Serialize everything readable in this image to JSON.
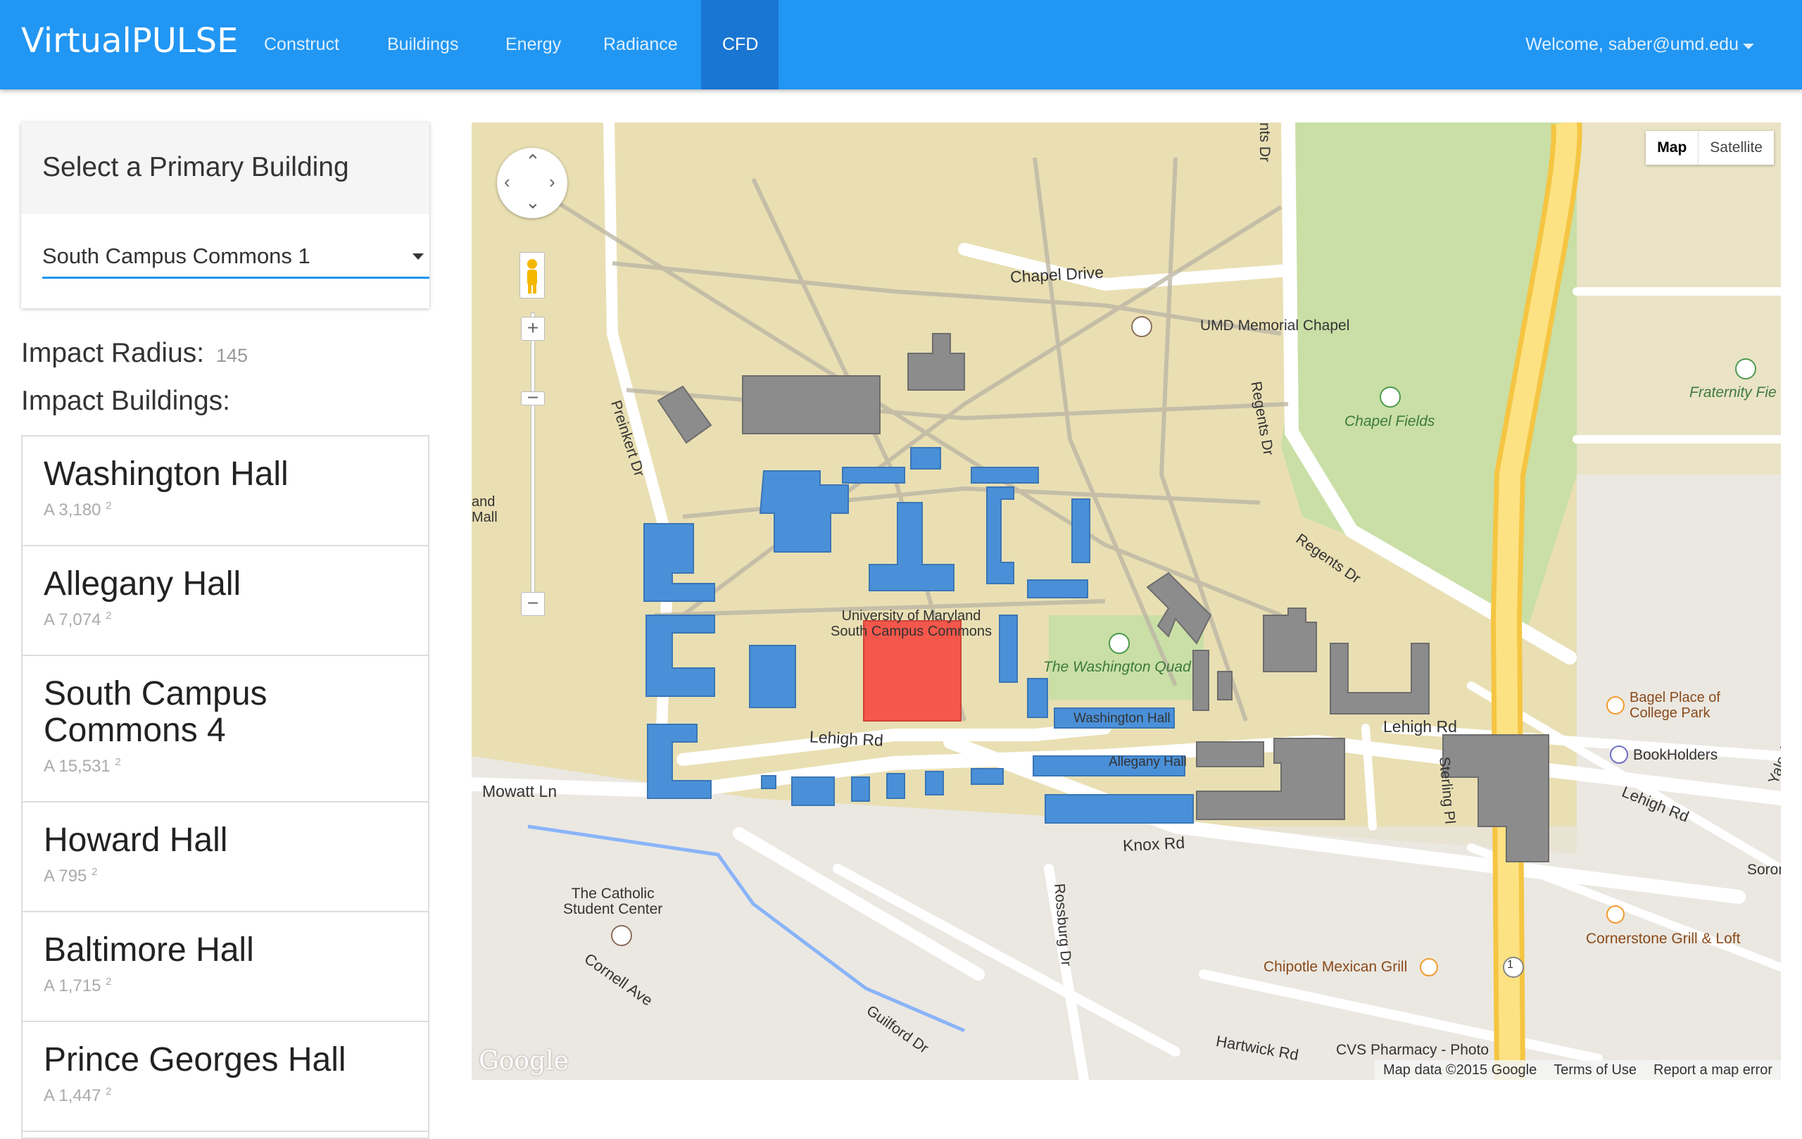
{
  "navbar": {
    "brand": "VirtualPULSE",
    "items": [
      "Construct",
      "Buildings",
      "Energy",
      "Radiance",
      "CFD"
    ],
    "active": "CFD",
    "user": "Welcome, saber@umd.edu"
  },
  "selector": {
    "title": "Select a Primary Building",
    "value": "South Campus Commons 1"
  },
  "impact": {
    "radius_label": "Impact Radius:",
    "radius_value": "145",
    "buildings_label": "Impact Buildings:",
    "buildings": [
      {
        "name": "Washington Hall",
        "area": "A 3,180",
        "unit": "2"
      },
      {
        "name": "Allegany Hall",
        "area": "A 7,074",
        "unit": "2"
      },
      {
        "name": "South Campus Commons 4",
        "area": "A 15,531",
        "unit": "2"
      },
      {
        "name": "Howard Hall",
        "area": "A 795",
        "unit": "2"
      },
      {
        "name": "Baltimore Hall",
        "area": "A 1,715",
        "unit": "2"
      },
      {
        "name": "Prince Georges Hall",
        "area": "A 1,447",
        "unit": "2"
      }
    ]
  },
  "map": {
    "type_map": "Map",
    "type_satellite": "Satellite",
    "labels": {
      "chapel_drive": "Chapel Drive",
      "umd_chapel": "UMD Memorial Chapel",
      "chapel_fields": "Chapel Fields",
      "fraternity": "Fraternity Fie",
      "regents_dr_1": "Regents Dr",
      "regents_dr_2": "Regents Dr",
      "regents_top": "nts Dr",
      "preinkert": "Preinkert Dr",
      "mall": "and\nMall",
      "umd_scc": "University of Maryland\nSouth Campus Commons",
      "washington_quad": "The Washington Quad",
      "washington_hall": "Washington Hall",
      "allegany_hall": "Allegany Hall",
      "lehigh_rd_1": "Lehigh Rd",
      "lehigh_rd_2": "Lehigh Rd",
      "lehigh_rd_3": "Lehigh Rd",
      "mowatt": "Mowatt Ln",
      "knox": "Knox Rd",
      "rossburg": "Rossburg Dr",
      "sterling": "Sterling Pl",
      "catholic": "The Catholic\nStudent Center",
      "cornell": "Cornell Ave",
      "guilford": "Guilford Dr",
      "hartwick": "Hartwick Rd",
      "chipotle": "Chipotle Mexican Grill",
      "cvs": "CVS Pharmacy - Photo",
      "bagel": "Bagel Place of\nCollege Park",
      "bookholders": "BookHolders",
      "cornerstone": "Cornerstone Grill & Loft",
      "yale": "Yale Ave",
      "soror": "Soror",
      "route": "1"
    },
    "footer": {
      "data": "Map data ©2015 Google",
      "terms": "Terms of Use",
      "report": "Report a map error"
    },
    "logo": "Google"
  },
  "colors": {
    "nav": "#2196f3",
    "nav_active": "#1976d2",
    "impact_building": "#4a90d9",
    "primary_building": "#f4574b",
    "other_building": "#8c8c8c"
  }
}
